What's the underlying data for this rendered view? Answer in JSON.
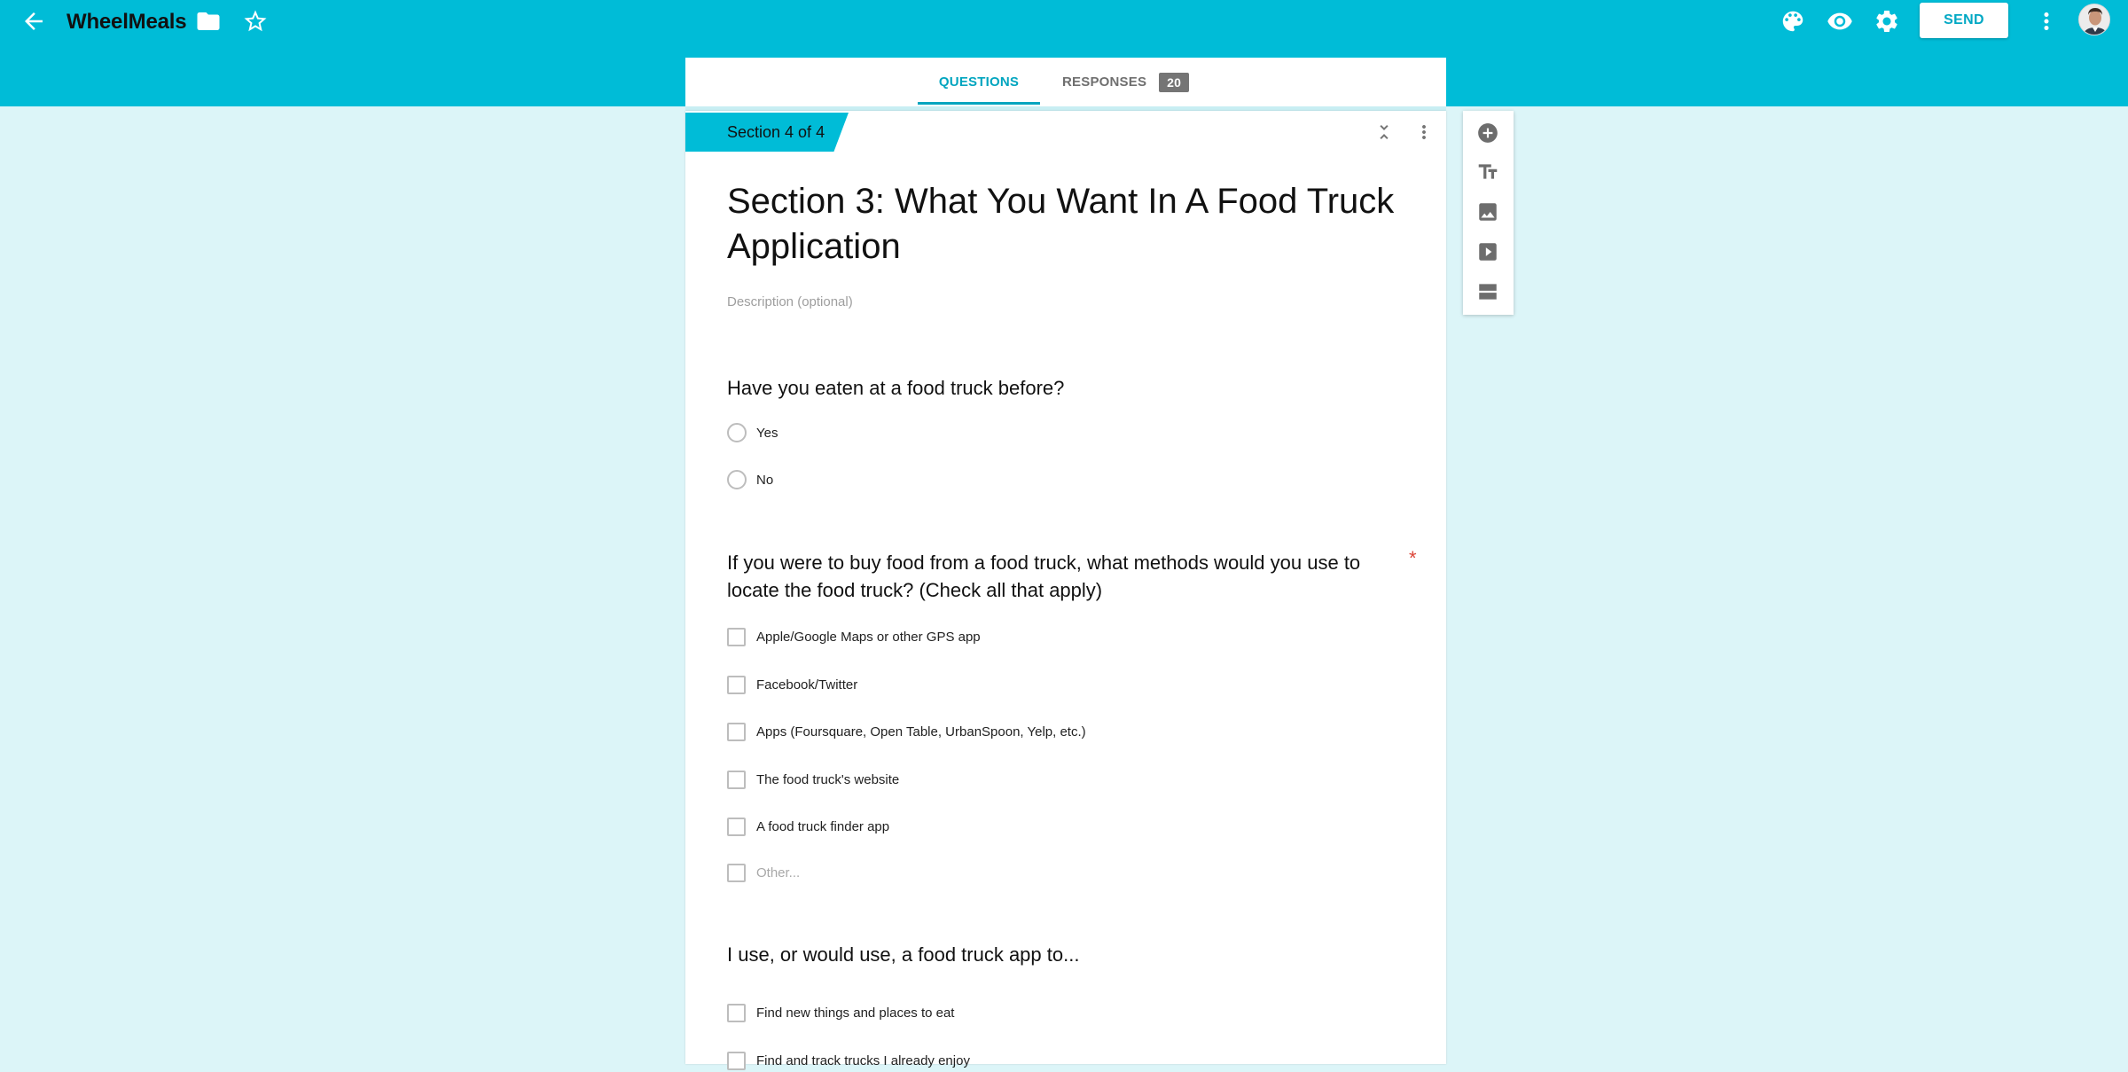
{
  "app": {
    "title": "WheelMeals",
    "accent_color": "#00bcd7",
    "background_color": "#dcf5f8"
  },
  "header": {
    "back_icon": "arrow-back-icon",
    "folder_icon": "folder-icon",
    "star_icon": "star-outline-icon",
    "palette_icon": "palette-icon",
    "preview_icon": "eye-icon",
    "settings_icon": "gear-icon",
    "send_label": "SEND",
    "more_icon": "more-vert-icon"
  },
  "tabs": {
    "questions_label": "QUESTIONS",
    "responses_label": "RESPONSES",
    "responses_count": "20"
  },
  "section": {
    "badge": "Section 4 of 4",
    "title": "Section 3: What You Want In A Food Truck Application",
    "description_placeholder": "Description (optional)",
    "collapse_icon": "collapse-icon",
    "menu_icon": "more-vert-icon"
  },
  "questions": [
    {
      "title": "Have you eaten at a food truck before?",
      "type": "radio",
      "required": false,
      "options": [
        "Yes",
        "No"
      ]
    },
    {
      "title": "If you were to buy food from a food truck, what methods would you use to locate the food truck? (Check all that apply)",
      "type": "checkbox",
      "required": true,
      "required_mark": "*",
      "options": [
        "Apple/Google Maps or other GPS app",
        "Facebook/Twitter",
        "Apps (Foursquare, Open Table, UrbanSpoon, Yelp, etc.)",
        "The food truck's website",
        "A food truck finder app"
      ],
      "other_placeholder": "Other..."
    },
    {
      "title": "I use, or would use, a food truck app to...",
      "type": "checkbox",
      "required": false,
      "options": [
        "Find new things and places to eat",
        "Find and track trucks I already enjoy"
      ]
    }
  ],
  "tools": [
    "add-question-icon",
    "title-text-icon",
    "image-icon",
    "video-icon",
    "section-icon"
  ]
}
